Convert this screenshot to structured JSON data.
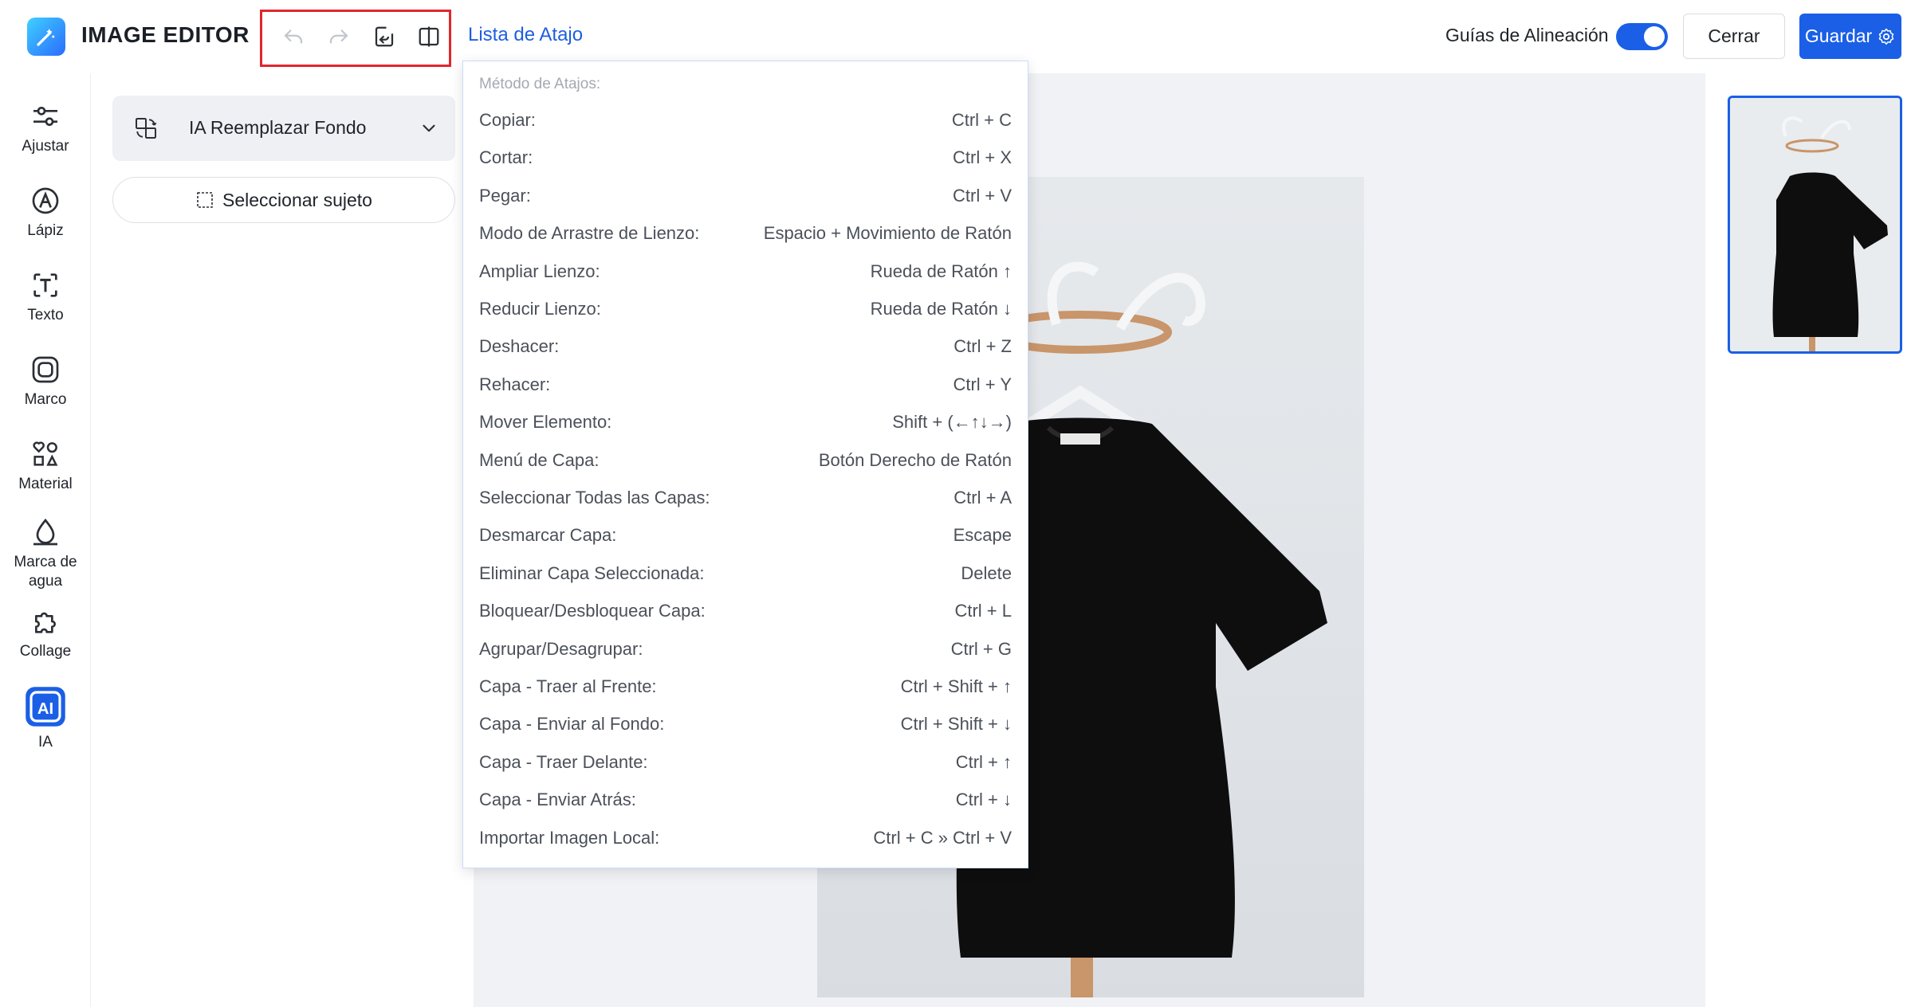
{
  "app": {
    "title": "IMAGE EDITOR",
    "icon": "magic-wand-icon"
  },
  "toolbar": {
    "undo_icon": "undo-icon",
    "redo_icon": "redo-icon",
    "reset_icon": "restore-icon",
    "compare_icon": "compare-icon",
    "shortcut_link": "Lista de Atajo",
    "alignment_guides_label": "Guías de Alineación",
    "alignment_guides_on": true,
    "close_label": "Cerrar",
    "save_label": "Guardar"
  },
  "colors": {
    "accent": "#1a5fe6",
    "highlight_box": "#e0272c"
  },
  "sidebar": {
    "items": [
      {
        "label": "Ajustar",
        "icon": "sliders-icon"
      },
      {
        "label": "Lápiz",
        "icon": "pencil-icon"
      },
      {
        "label": "Texto",
        "icon": "text-icon"
      },
      {
        "label": "Marco",
        "icon": "frame-icon"
      },
      {
        "label": "Material",
        "icon": "shapes-icon"
      },
      {
        "label": "Marca de agua",
        "icon": "watermark-icon"
      },
      {
        "label": "Collage",
        "icon": "puzzle-icon"
      },
      {
        "label": "IA",
        "icon": "ai-icon"
      }
    ]
  },
  "panel": {
    "feature_title": "IA Reemplazar Fondo",
    "select_subject_label": "Seleccionar sujeto"
  },
  "shortcuts": {
    "header": "Método de Atajos:",
    "rows": [
      {
        "action": "Copiar:",
        "keys": "Ctrl + C"
      },
      {
        "action": "Cortar:",
        "keys": "Ctrl + X"
      },
      {
        "action": "Pegar:",
        "keys": "Ctrl + V"
      },
      {
        "action": "Modo de Arrastre de Lienzo:",
        "keys": "Espacio + Movimiento de Ratón"
      },
      {
        "action": "Ampliar Lienzo:",
        "keys": "Rueda de Ratón ↑"
      },
      {
        "action": "Reducir Lienzo:",
        "keys": "Rueda de Ratón ↓"
      },
      {
        "action": "Deshacer:",
        "keys": "Ctrl + Z"
      },
      {
        "action": "Rehacer:",
        "keys": "Ctrl + Y"
      },
      {
        "action": "Mover Elemento:",
        "keys": "Shift + (←↑↓→)"
      },
      {
        "action": "Menú de Capa:",
        "keys": "Botón Derecho de Ratón"
      },
      {
        "action": "Seleccionar Todas las Capas:",
        "keys": "Ctrl + A"
      },
      {
        "action": "Desmarcar Capa:",
        "keys": "Escape"
      },
      {
        "action": "Eliminar Capa Seleccionada:",
        "keys": "Delete"
      },
      {
        "action": "Bloquear/Desbloquear Capa:",
        "keys": "Ctrl + L"
      },
      {
        "action": "Agrupar/Desagrupar:",
        "keys": "Ctrl + G"
      },
      {
        "action": "Capa - Traer al Frente:",
        "keys": "Ctrl + Shift + ↑"
      },
      {
        "action": "Capa - Enviar al Fondo:",
        "keys": "Ctrl + Shift + ↓"
      },
      {
        "action": "Capa - Traer Delante:",
        "keys": "Ctrl + ↑"
      },
      {
        "action": "Capa - Enviar Atrás:",
        "keys": "Ctrl + ↓"
      },
      {
        "action": "Importar Imagen Local:",
        "keys": "Ctrl + C » Ctrl + V"
      }
    ]
  }
}
